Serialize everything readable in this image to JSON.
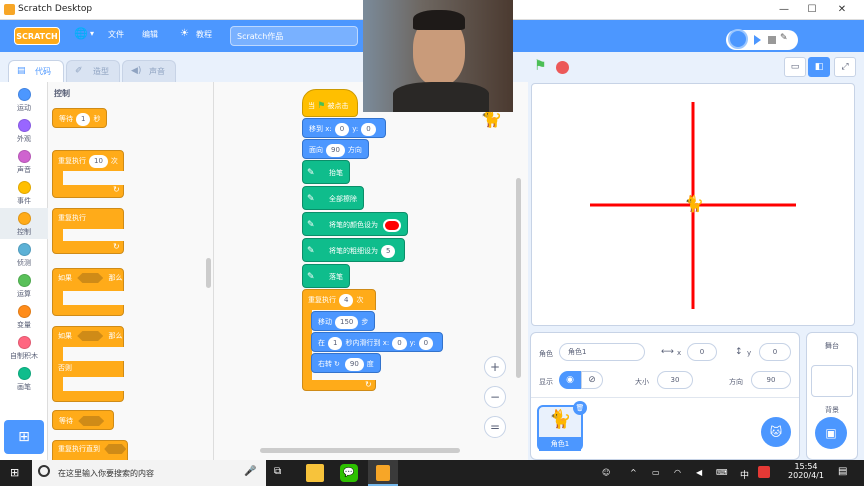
{
  "window": {
    "title": "Scratch Desktop",
    "min": "—",
    "max": "☐",
    "close": "✕"
  },
  "menubar": {
    "logo": "SCRATCH",
    "globe": "🌐",
    "file": "文件",
    "edit": "编辑",
    "tutorials": "教程",
    "project_title": "Scratch作品"
  },
  "tabs": {
    "code": "代码",
    "costumes": "造型",
    "sounds": "声音"
  },
  "categories": [
    {
      "label": "运动",
      "color": "#4c97ff"
    },
    {
      "label": "外观",
      "color": "#9966ff"
    },
    {
      "label": "声音",
      "color": "#cf63cf"
    },
    {
      "label": "事件",
      "color": "#ffbf00"
    },
    {
      "label": "控制",
      "color": "#ffab19"
    },
    {
      "label": "侦测",
      "color": "#5cb1d6"
    },
    {
      "label": "运算",
      "color": "#59c059"
    },
    {
      "label": "变量",
      "color": "#ff8c1a"
    },
    {
      "label": "自制积木",
      "color": "#ff6680"
    },
    {
      "label": "画笔",
      "color": "#0fbd8c"
    }
  ],
  "palette": {
    "heading": "控制",
    "wait": "等待",
    "wait_val": "1",
    "wait_unit": "秒",
    "repeat": "重复执行",
    "repeat_val": "10",
    "repeat_unit": "次",
    "forever": "重复执行",
    "if": "如果",
    "then": "那么",
    "if2": "如果",
    "then2": "那么",
    "else": "否则",
    "wait_until": "等待",
    "repeat_until": "重复执行直到"
  },
  "script": {
    "hat": "当",
    "hat_suffix": "被点击",
    "goto": "移到 x:",
    "goto_x": "0",
    "goto_y_label": "y:",
    "goto_y": "0",
    "point": "面向",
    "point_val": "90",
    "point_unit": "方向",
    "pen_up": "抬笔",
    "clear": "全部擦除",
    "set_color": "将笔的颜色设为",
    "set_size": "将笔的粗细设为",
    "size_val": "5",
    "pen_down": "落笔",
    "repeat": "重复执行",
    "repeat_val": "4",
    "repeat_unit": "次",
    "move": "移动",
    "move_val": "150",
    "move_unit": "步",
    "glide": "在",
    "glide_val": "1",
    "glide_mid": "秒内滑行到 x:",
    "glide_x": "0",
    "glide_y_label": "y:",
    "glide_y": "0",
    "turn": "右转",
    "turn_val": "90",
    "turn_unit": "度"
  },
  "zoom": {
    "in": "+",
    "out": "−",
    "reset": "="
  },
  "sprite": {
    "sprite_label": "角色",
    "sprite_name": "角色1",
    "x_label": "x",
    "x_val": "0",
    "y_label": "y",
    "y_val": "0",
    "show_label": "显示",
    "size_label": "大小",
    "size_val": "30",
    "dir_label": "方向",
    "dir_val": "90",
    "thumb_label": "角色1"
  },
  "backdrop": {
    "title": "舞台",
    "label": "背景"
  },
  "taskbar": {
    "search_placeholder": "在这里输入你要搜索的内容",
    "time": "15:54",
    "date": "2020/4/1",
    "ime": "中"
  }
}
